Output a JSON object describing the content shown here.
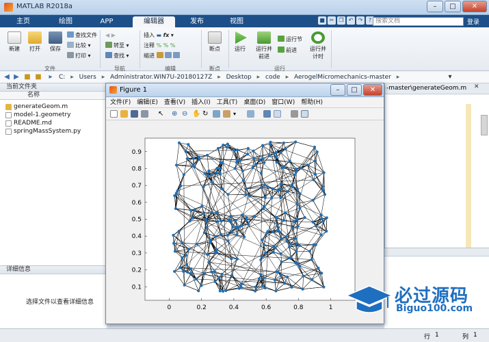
{
  "app": {
    "title": "MATLAB R2018a"
  },
  "tabs": [
    "主页",
    "绘图",
    "APP",
    "编辑器",
    "发布",
    "视图"
  ],
  "search": {
    "placeholder": "搜索文档",
    "login": "登录"
  },
  "ribbon": {
    "file": {
      "label": "文件",
      "new": "新建",
      "open": "打开",
      "save": "保存",
      "find_files": "查找文件",
      "compare": "比较",
      "print": "打印"
    },
    "nav": {
      "label": "导航",
      "goto": "转至",
      "find": "查找"
    },
    "edit": {
      "label": "编辑",
      "insert": "插入",
      "comment": "注释",
      "indent": "缩进"
    },
    "breakpoints": {
      "label": "断点",
      "bp": "断点"
    },
    "run": {
      "label": "运行",
      "run": "运行",
      "run_advance_1": "运行并",
      "run_advance_2": "前进",
      "run_section": "运行节",
      "advance": "前进",
      "run_time_1": "运行并",
      "run_time_2": "计时"
    }
  },
  "address": {
    "crumbs": [
      "C:",
      "Users",
      "Administrator.WIN7U-20180127Z",
      "Desktop",
      "code",
      "AerogelMicromechanics-master"
    ]
  },
  "left_panel": {
    "title": "当前文件夹",
    "col_name": "名称",
    "files": [
      "generateGeom.m",
      "model-1.geometry",
      "README.md",
      "springMassSystem.py"
    ],
    "details_title": "详细信息",
    "details_hint": "选择文件以查看详细信息"
  },
  "editor": {
    "tab_path": "-master\\generateGeom.m"
  },
  "status": {
    "row_label": "行",
    "row_value": "1",
    "col_label": "列",
    "col_value": "1"
  },
  "figure": {
    "title": "Figure 1",
    "menu": [
      "文件(F)",
      "编辑(E)",
      "查看(V)",
      "插入(I)",
      "工具(T)",
      "桌面(D)",
      "窗口(W)",
      "帮助(H)"
    ],
    "node_color": "#1f6fb5"
  },
  "chart_data": {
    "type": "scatter",
    "description_series": "nodes connected by edges (spring-mass network)",
    "xlim": [
      -0.15,
      1.15
    ],
    "ylim": [
      0.02,
      0.98
    ],
    "xticks": [
      "0",
      "0.2",
      "0.4",
      "0.6",
      "0.8",
      "1"
    ],
    "yticks": [
      "0.1",
      "0.2",
      "0.3",
      "0.4",
      "0.5",
      "0.6",
      "0.7",
      "0.8",
      "0.9"
    ],
    "node_count": 260,
    "edges_per_node": 6
  },
  "watermark": {
    "line1": "必过源码",
    "line2": "Biguo100.com"
  }
}
